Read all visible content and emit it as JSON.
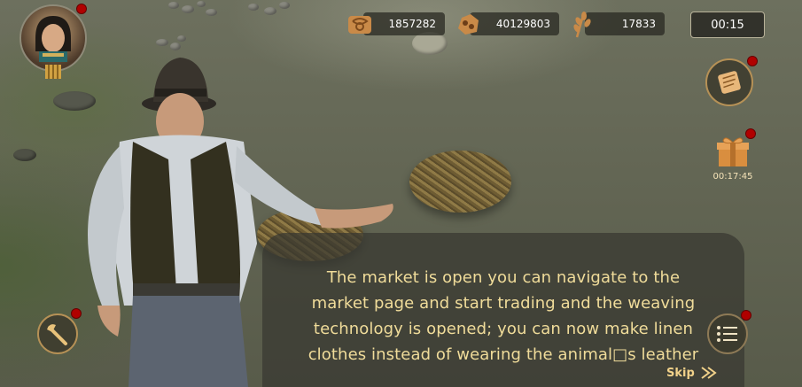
{
  "resources": [
    {
      "icon": "scroll-papyrus-icon",
      "value": "1857282"
    },
    {
      "icon": "ore-nugget-icon",
      "value": "40129803"
    },
    {
      "icon": "wheat-icon",
      "value": "17833"
    }
  ],
  "timer": "00:15",
  "gift": {
    "countdown": "00:17:45"
  },
  "dialog": {
    "line1": "The market is open you can navigate to the",
    "line2": "market page and start trading and the weaving",
    "line3": "technology is opened; you can now make linen",
    "line4": "clothes instead of wearing the animal□s leather"
  },
  "skip_label": "Skip",
  "colors": {
    "dialog_text": "#f0dc9a",
    "accent_gold": "#b69156",
    "notification": "#b00000"
  }
}
